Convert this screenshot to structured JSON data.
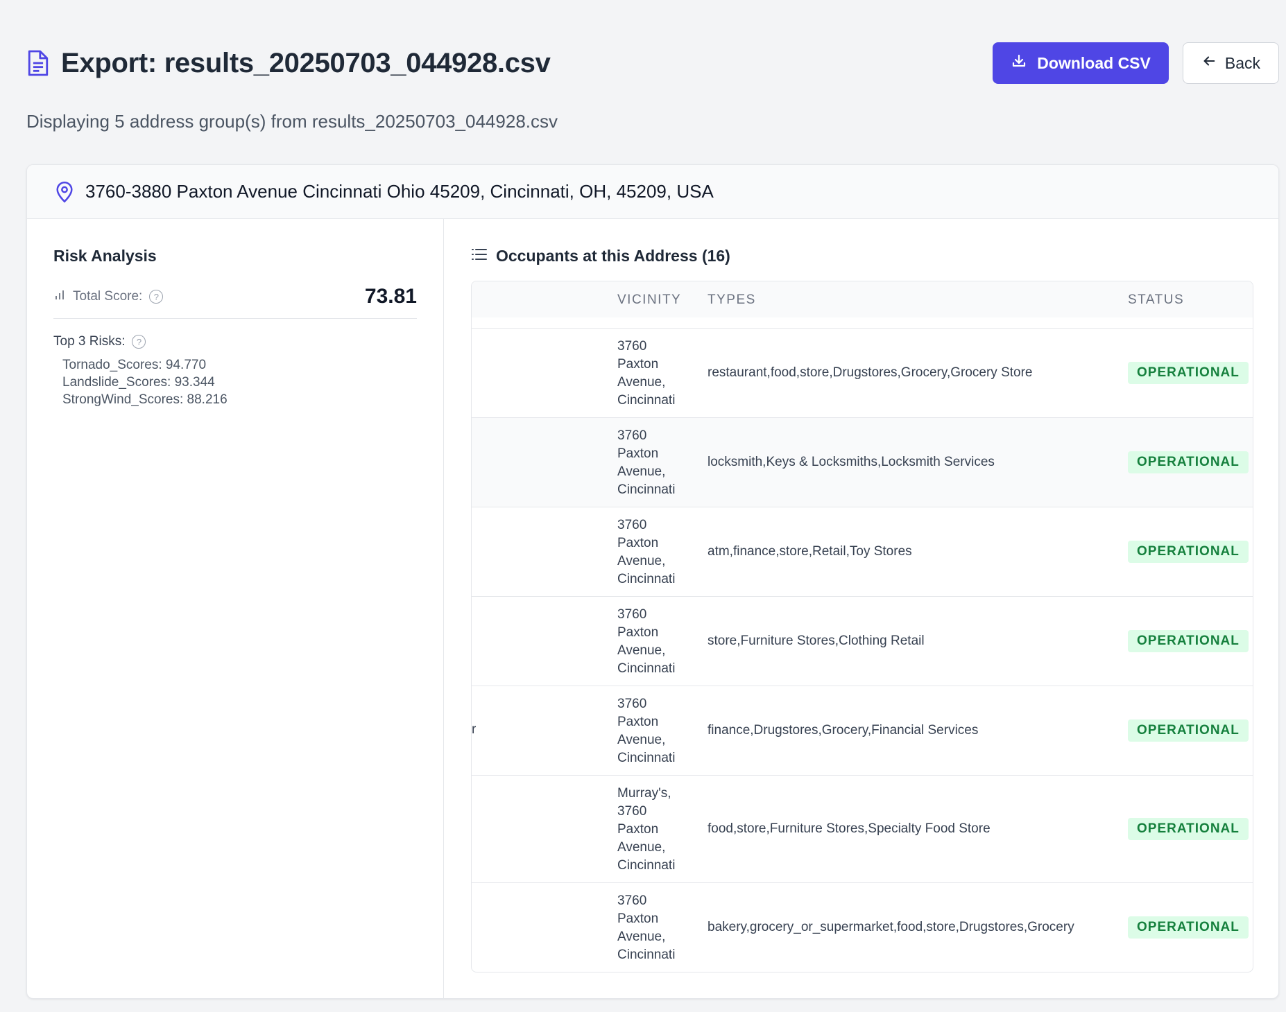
{
  "header": {
    "title": "Export: results_20250703_044928.csv",
    "download_label": "Download CSV",
    "back_label": "Back"
  },
  "subtitle": "Displaying 5 address group(s) from results_20250703_044928.csv",
  "group": {
    "address": "3760-3880 Paxton Avenue Cincinnati Ohio 45209, Cincinnati, OH, 45209, USA",
    "risk": {
      "title": "Risk Analysis",
      "total_score_label": "Total Score:",
      "total_score": "73.81",
      "top_label": "Top 3 Risks:",
      "items": [
        "Tornado_Scores: 94.770",
        "Landslide_Scores: 93.344",
        "StrongWind_Scores: 88.216"
      ]
    },
    "occupants": {
      "title": "Occupants at this Address (16)",
      "columns": {
        "vicinity": "VICINITY",
        "types": "TYPES",
        "status": "STATUS"
      },
      "rows": [
        {
          "cut": "",
          "vicinity": [
            "3760",
            "Paxton",
            "Avenue,",
            "Cincinnati"
          ],
          "types": "restaurant,food,store,Drugstores,Grocery,Grocery Store",
          "status": "OPERATIONAL"
        },
        {
          "cut": "",
          "vicinity": [
            "3760",
            "Paxton",
            "Avenue,",
            "Cincinnati"
          ],
          "types": "locksmith,Keys & Locksmiths,Locksmith Services",
          "status": "OPERATIONAL"
        },
        {
          "cut": "",
          "vicinity": [
            "3760",
            "Paxton",
            "Avenue,",
            "Cincinnati"
          ],
          "types": "atm,finance,store,Retail,Toy Stores",
          "status": "OPERATIONAL"
        },
        {
          "cut": "",
          "vicinity": [
            "3760",
            "Paxton",
            "Avenue,",
            "Cincinnati"
          ],
          "types": "store,Furniture Stores,Clothing Retail",
          "status": "OPERATIONAL"
        },
        {
          "cut": "r",
          "vicinity": [
            "3760",
            "Paxton",
            "Avenue,",
            "Cincinnati"
          ],
          "types": "finance,Drugstores,Grocery,Financial Services",
          "status": "OPERATIONAL"
        },
        {
          "cut": "",
          "vicinity": [
            "Murray's,",
            "3760",
            "Paxton",
            "Avenue,",
            "Cincinnati"
          ],
          "types": "food,store,Furniture Stores,Specialty Food Store",
          "status": "OPERATIONAL"
        },
        {
          "cut": "",
          "vicinity": [
            "3760",
            "Paxton",
            "Avenue,",
            "Cincinnati"
          ],
          "types": "bakery,grocery_or_supermarket,food,store,Drugstores,Grocery",
          "status": "OPERATIONAL"
        }
      ]
    }
  },
  "colors": {
    "accent": "#4f46e5",
    "badge_bg": "#dcfce7",
    "badge_text": "#15803d"
  }
}
